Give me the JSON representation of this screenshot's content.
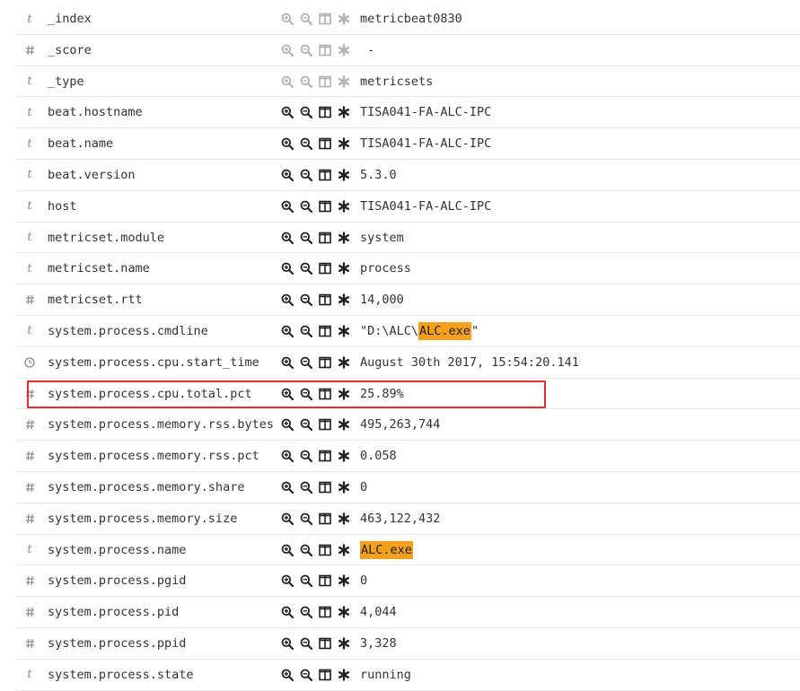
{
  "colors": {
    "highlight": "#f5a01a",
    "annotation_box": "#e03030",
    "row_border": "#e6e6e6"
  },
  "action_icons": [
    "zoom-in-icon",
    "zoom-out-icon",
    "columns-icon",
    "asterisk-icon"
  ],
  "rows": [
    {
      "type": "string",
      "field": "_index",
      "value": "metricbeat0830",
      "disabled": true
    },
    {
      "type": "number",
      "field": "_score",
      "value": " -",
      "disabled": true
    },
    {
      "type": "string",
      "field": "_type",
      "value": "metricsets",
      "disabled": true
    },
    {
      "type": "string",
      "field": "beat.hostname",
      "value": "TISA041-FA-ALC-IPC"
    },
    {
      "type": "string",
      "field": "beat.name",
      "value": "TISA041-FA-ALC-IPC"
    },
    {
      "type": "string",
      "field": "beat.version",
      "value": "5.3.0"
    },
    {
      "type": "string",
      "field": "host",
      "value": "TISA041-FA-ALC-IPC"
    },
    {
      "type": "string",
      "field": "metricset.module",
      "value": "system"
    },
    {
      "type": "string",
      "field": "metricset.name",
      "value": "process"
    },
    {
      "type": "number",
      "field": "metricset.rtt",
      "value": "14,000"
    },
    {
      "type": "string",
      "field": "system.process.cmdline",
      "value_prefix": "\"D:\\ALC\\",
      "value_highlight": "ALC.exe",
      "value_suffix": "\""
    },
    {
      "type": "date",
      "field": "system.process.cpu.start_time",
      "value": "August 30th 2017, 15:54:20.141"
    },
    {
      "type": "number",
      "field": "system.process.cpu.total.pct",
      "value": "25.89%",
      "annotated": true
    },
    {
      "type": "number",
      "field": "system.process.memory.rss.bytes",
      "value": "495,263,744"
    },
    {
      "type": "number",
      "field": "system.process.memory.rss.pct",
      "value": "0.058"
    },
    {
      "type": "number",
      "field": "system.process.memory.share",
      "value": "0"
    },
    {
      "type": "number",
      "field": "system.process.memory.size",
      "value": "463,122,432"
    },
    {
      "type": "string",
      "field": "system.process.name",
      "value_prefix": "",
      "value_highlight": "ALC.exe",
      "value_suffix": ""
    },
    {
      "type": "number",
      "field": "system.process.pgid",
      "value": "0"
    },
    {
      "type": "number",
      "field": "system.process.pid",
      "value": "4,044"
    },
    {
      "type": "number",
      "field": "system.process.ppid",
      "value": "3,328"
    },
    {
      "type": "string",
      "field": "system.process.state",
      "value": "running"
    }
  ]
}
